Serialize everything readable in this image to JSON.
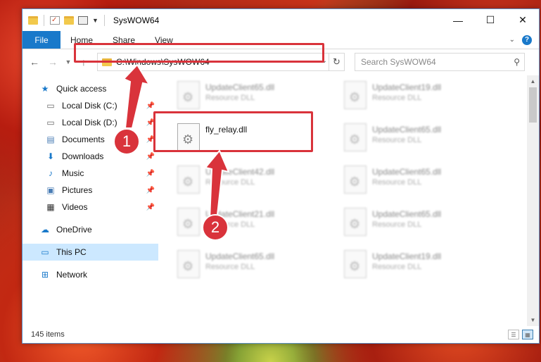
{
  "window": {
    "title": "SysWOW64",
    "controls": [
      "—",
      "☐",
      "✕"
    ]
  },
  "ribbon": {
    "file": "File",
    "tabs": [
      "Home",
      "Share",
      "View"
    ]
  },
  "address": {
    "path": "C:\\Windows\\SysWOW64",
    "search_placeholder": "Search SysWOW64"
  },
  "sidebar": {
    "quick_access": "Quick access",
    "items": [
      {
        "label": "Local Disk (C:)"
      },
      {
        "label": "Local Disk (D:)"
      },
      {
        "label": "Documents"
      },
      {
        "label": "Downloads"
      },
      {
        "label": "Music"
      },
      {
        "label": "Pictures"
      },
      {
        "label": "Videos"
      }
    ],
    "onedrive": "OneDrive",
    "thispc": "This PC",
    "network": "Network"
  },
  "files": {
    "blurred": [
      {
        "name": "UpdateClient65.dll",
        "type": "Resource DLL"
      },
      {
        "name": "UpdateClient19.dll",
        "type": "Resource DLL"
      },
      {
        "name": "",
        "type": ""
      },
      {
        "name": "UpdateClient65.dll",
        "type": "Resource DLL"
      },
      {
        "name": "UpdateClient42.dll",
        "type": "Resource DLL"
      },
      {
        "name": "UpdateClient65.dll",
        "type": "Resource DLL"
      },
      {
        "name": "UpdateClient21.dll",
        "type": "Resource DLL"
      },
      {
        "name": "UpdateClient65.dll",
        "type": "Resource DLL"
      },
      {
        "name": "UpdateClient65.dll",
        "type": "Resource DLL"
      },
      {
        "name": "UpdateClient19.dll",
        "type": "Resource DLL"
      }
    ],
    "focused": {
      "name": "fly_relay.dll"
    }
  },
  "status": {
    "count": "145 items"
  },
  "annotations": {
    "badge1": "1",
    "badge2": "2",
    "color": "#d9333b"
  }
}
